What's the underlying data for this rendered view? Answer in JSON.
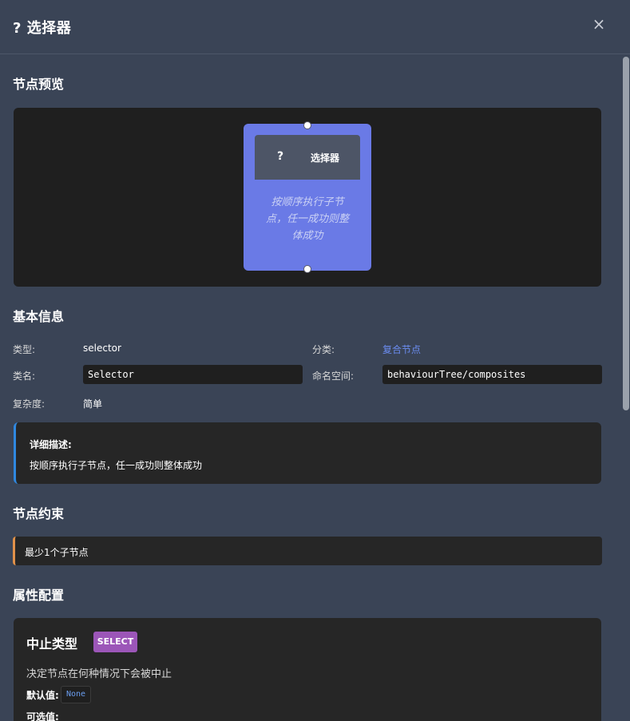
{
  "dialog": {
    "title": "? 选择器",
    "close_glyph": "×"
  },
  "preview": {
    "section_title": "节点预览",
    "node": {
      "icon": "?",
      "name": "选择器",
      "description": "按顺序执行子节点，任一成功则整体成功",
      "color": "#6a7ae6"
    }
  },
  "basic_info": {
    "section_title": "基本信息",
    "type_label": "类型:",
    "type_value": "selector",
    "category_label": "分类:",
    "category_value": "复合节点",
    "class_label": "类名:",
    "class_value": "Selector",
    "namespace_label": "命名空间:",
    "namespace_value": "behaviourTree/composites",
    "complexity_label": "复杂度:",
    "complexity_value": "简单",
    "detail_label": "详细描述:",
    "detail_text": "按顺序执行子节点，任一成功则整体成功"
  },
  "constraints": {
    "section_title": "节点约束",
    "items": [
      "最少1个子节点"
    ]
  },
  "properties": {
    "section_title": "属性配置",
    "items": [
      {
        "name": "中止类型",
        "type_badge": "SELECT",
        "description": "决定节点在何种情况下会被中止",
        "default_label": "默认值:",
        "default_value": "None",
        "options_label": "可选值:"
      }
    ]
  },
  "colors": {
    "accent_blue": "#2f88e0",
    "accent_orange": "#e0914a",
    "badge_purple": "#9c56b8",
    "link": "#6b8cf0"
  }
}
